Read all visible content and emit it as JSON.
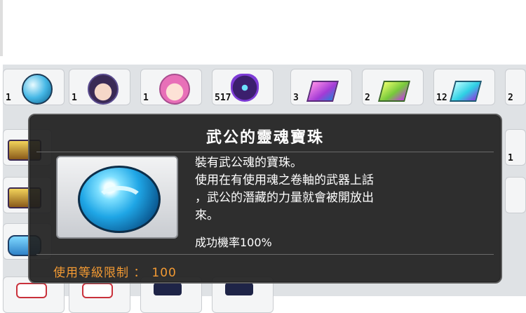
{
  "tooltip": {
    "title": "武公的靈魂寶珠",
    "description": "裝有武公魂的寶珠。\n使用在有使用魂之卷軸的武器上話\n，武公的潛藏的力量就會被開放出\n來。",
    "success_rate": "成功機率100%",
    "requirement_label": "使用等級限制 ：",
    "requirement_value": "100",
    "item_icon": "blue-soul-orb-icon"
  },
  "inventory": {
    "row1": [
      {
        "icon": "gloved-orb-icon",
        "qty": "1"
      },
      {
        "icon": "dark-hair-face-icon",
        "qty": "1"
      },
      {
        "icon": "pink-hair-face-icon",
        "qty": "1"
      },
      {
        "icon": "purple-mask-icon",
        "qty": "517"
      },
      {
        "icon": "pink-gem-icon",
        "qty": "3"
      },
      {
        "icon": "green-gem-icon",
        "qty": "2"
      },
      {
        "icon": "cyan-gem-icon",
        "qty": "12"
      },
      {
        "icon": "partial-item-icon",
        "qty": "2"
      }
    ],
    "row2_qty": "1",
    "colors": {
      "tooltip_bg": "#1e1e1e",
      "requirement_text": "#f39a33"
    }
  }
}
